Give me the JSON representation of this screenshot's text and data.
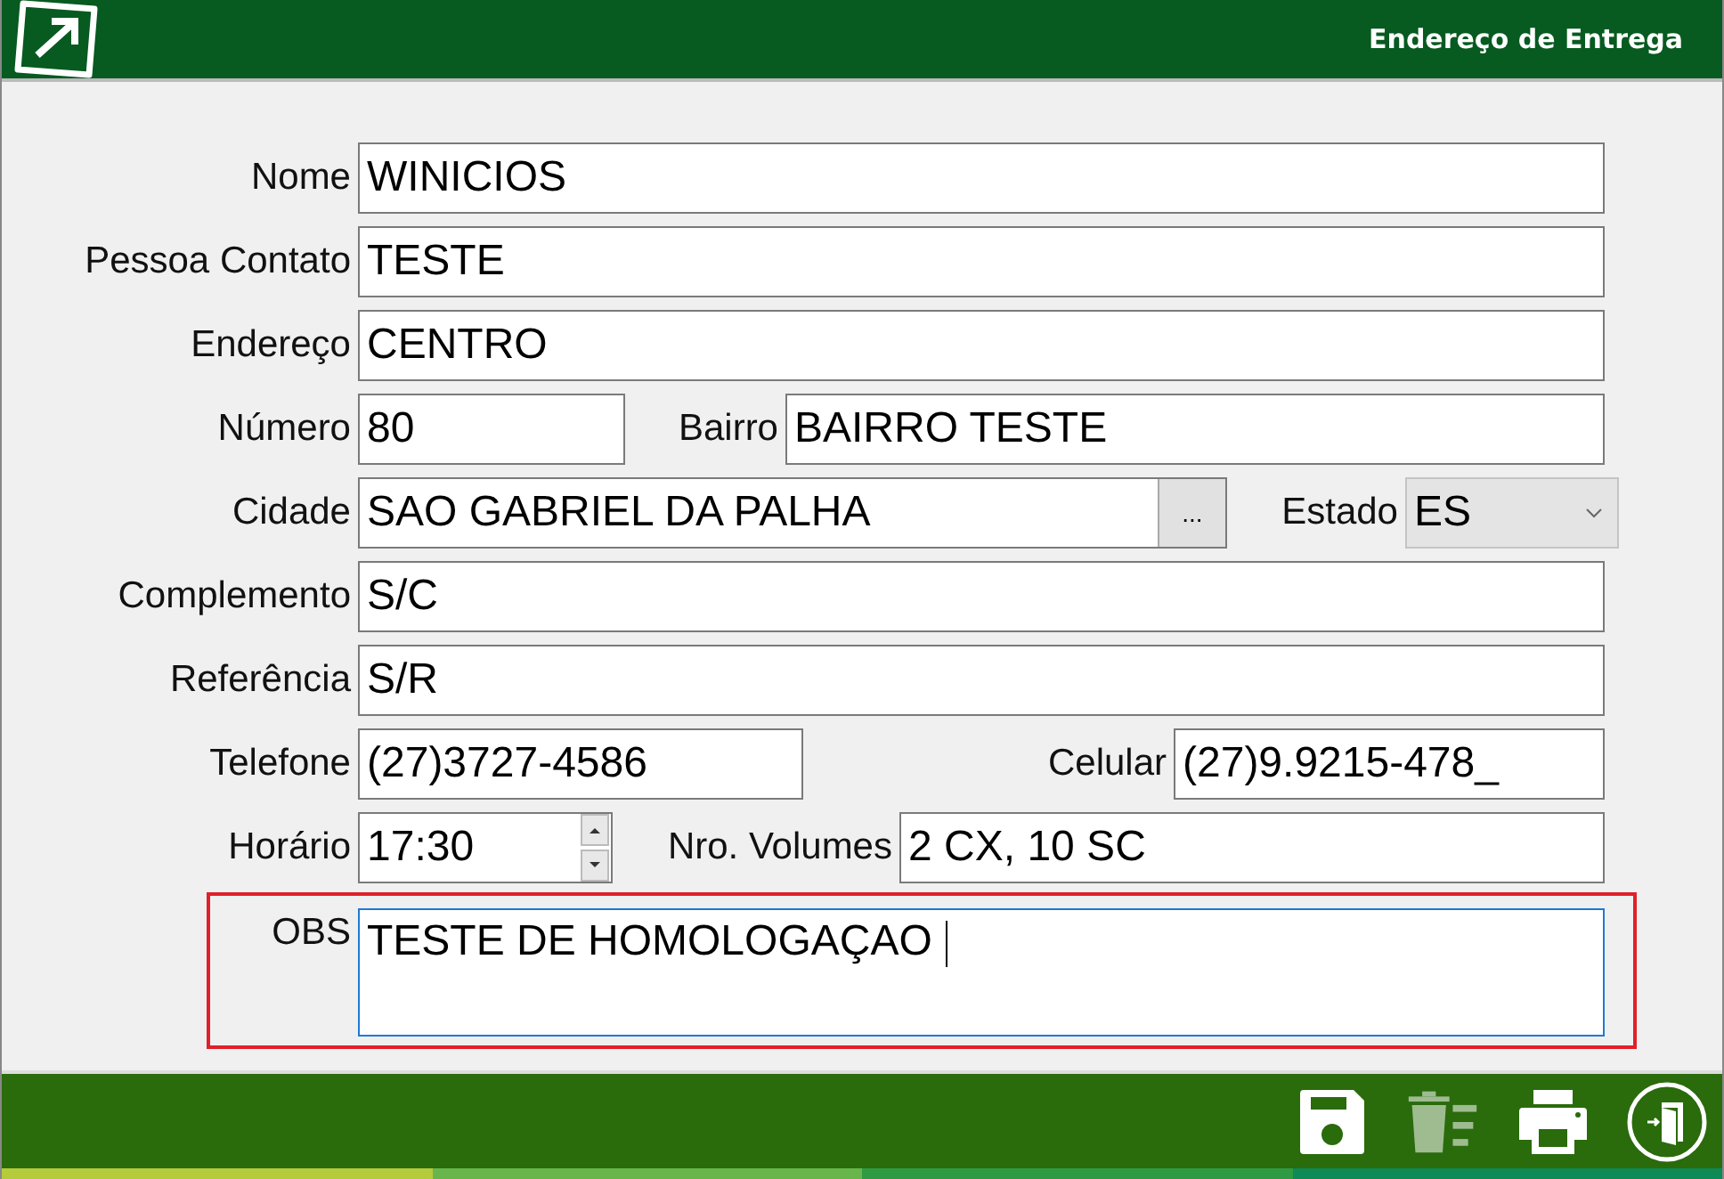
{
  "window": {
    "title": "Endereço de Entrega"
  },
  "rows": [
    {
      "highlighted": false,
      "items": [
        {
          "kind": "text",
          "label": "Nome",
          "value": "WINICIOS"
        }
      ]
    },
    {
      "highlighted": false,
      "items": [
        {
          "kind": "text",
          "label": "Pessoa Contato",
          "value": "TESTE"
        }
      ]
    },
    {
      "highlighted": false,
      "items": [
        {
          "kind": "text",
          "label": "Endereço",
          "value": "CENTRO"
        }
      ]
    },
    {
      "highlighted": false,
      "items": [
        {
          "kind": "text",
          "label": "Número",
          "value": "80"
        },
        {
          "kind": "text",
          "label": "Bairro",
          "value": "BAIRRO TESTE"
        }
      ]
    },
    {
      "highlighted": false,
      "items": [
        {
          "kind": "lookup",
          "label": "Cidade",
          "value": "SAO GABRIEL DA PALHA",
          "button": "..."
        },
        {
          "kind": "select",
          "label": "Estado",
          "value": "ES"
        }
      ]
    },
    {
      "highlighted": false,
      "items": [
        {
          "kind": "text",
          "label": "Complemento",
          "value": "S/C"
        }
      ]
    },
    {
      "highlighted": false,
      "items": [
        {
          "kind": "text",
          "label": "Referência",
          "value": "S/R"
        }
      ]
    },
    {
      "highlighted": false,
      "items": [
        {
          "kind": "text",
          "label": "Telefone",
          "value": "(27)3727-4586"
        },
        {
          "kind": "text",
          "label": "Celular",
          "value": "(27)9.9215-478_"
        }
      ]
    },
    {
      "highlighted": false,
      "items": [
        {
          "kind": "spinner",
          "label": "Horário",
          "value": "17:30"
        },
        {
          "kind": "text",
          "label": "Nro. Volumes",
          "value": "2 CX, 10 SC"
        }
      ]
    },
    {
      "highlighted": true,
      "items": [
        {
          "kind": "textarea",
          "label": "OBS",
          "value": "TESTE DE HOMOLOGAÇAO",
          "focused": true
        }
      ]
    }
  ],
  "toolbar": [
    {
      "kind": "save",
      "disabled": false
    },
    {
      "kind": "delete",
      "disabled": true
    },
    {
      "kind": "print",
      "disabled": false
    },
    {
      "kind": "exit",
      "disabled": false
    }
  ]
}
